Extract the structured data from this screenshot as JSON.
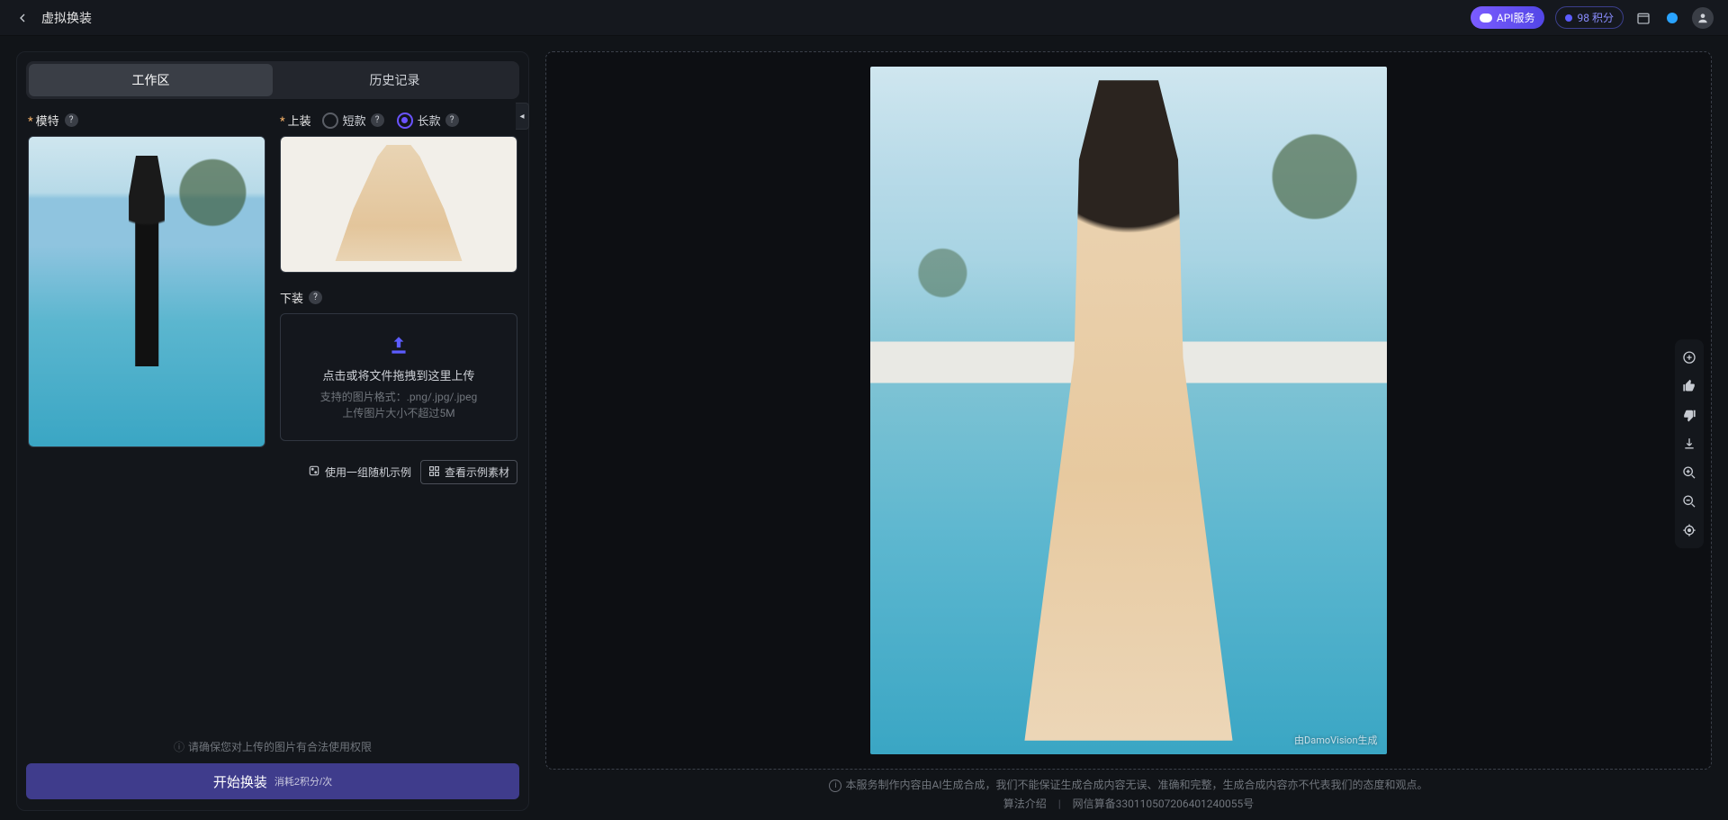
{
  "header": {
    "title": "虚拟换装",
    "api_label": "API服务",
    "credits_label": "98 积分"
  },
  "tabs": {
    "workspace": "工作区",
    "history": "历史记录"
  },
  "fields": {
    "model_label": "模特",
    "top_label": "上装",
    "bottom_label": "下装",
    "radio_short": "短款",
    "radio_long": "长款"
  },
  "upload": {
    "title": "点击或将文件拖拽到这里上传",
    "hint1": "支持的图片格式：.png/.jpg/.jpeg",
    "hint2": "上传图片大小不超过5M"
  },
  "actions": {
    "random_sample": "使用一组随机示例",
    "view_samples": "查看示例素材"
  },
  "footer": {
    "legal": "请确保您对上传的图片有合法使用权限",
    "primary": "开始换装",
    "primary_sub": "消耗2积分/次"
  },
  "result": {
    "watermark": "由DamoVision生成"
  },
  "disclaimer": {
    "line1": "本服务制作内容由AI生成合成，我们不能保证生成合成内容无误、准确和完整，生成合成内容亦不代表我们的态度和观点。",
    "algo_link": "算法介绍",
    "filing": "网信算备330110507206401240055号"
  }
}
